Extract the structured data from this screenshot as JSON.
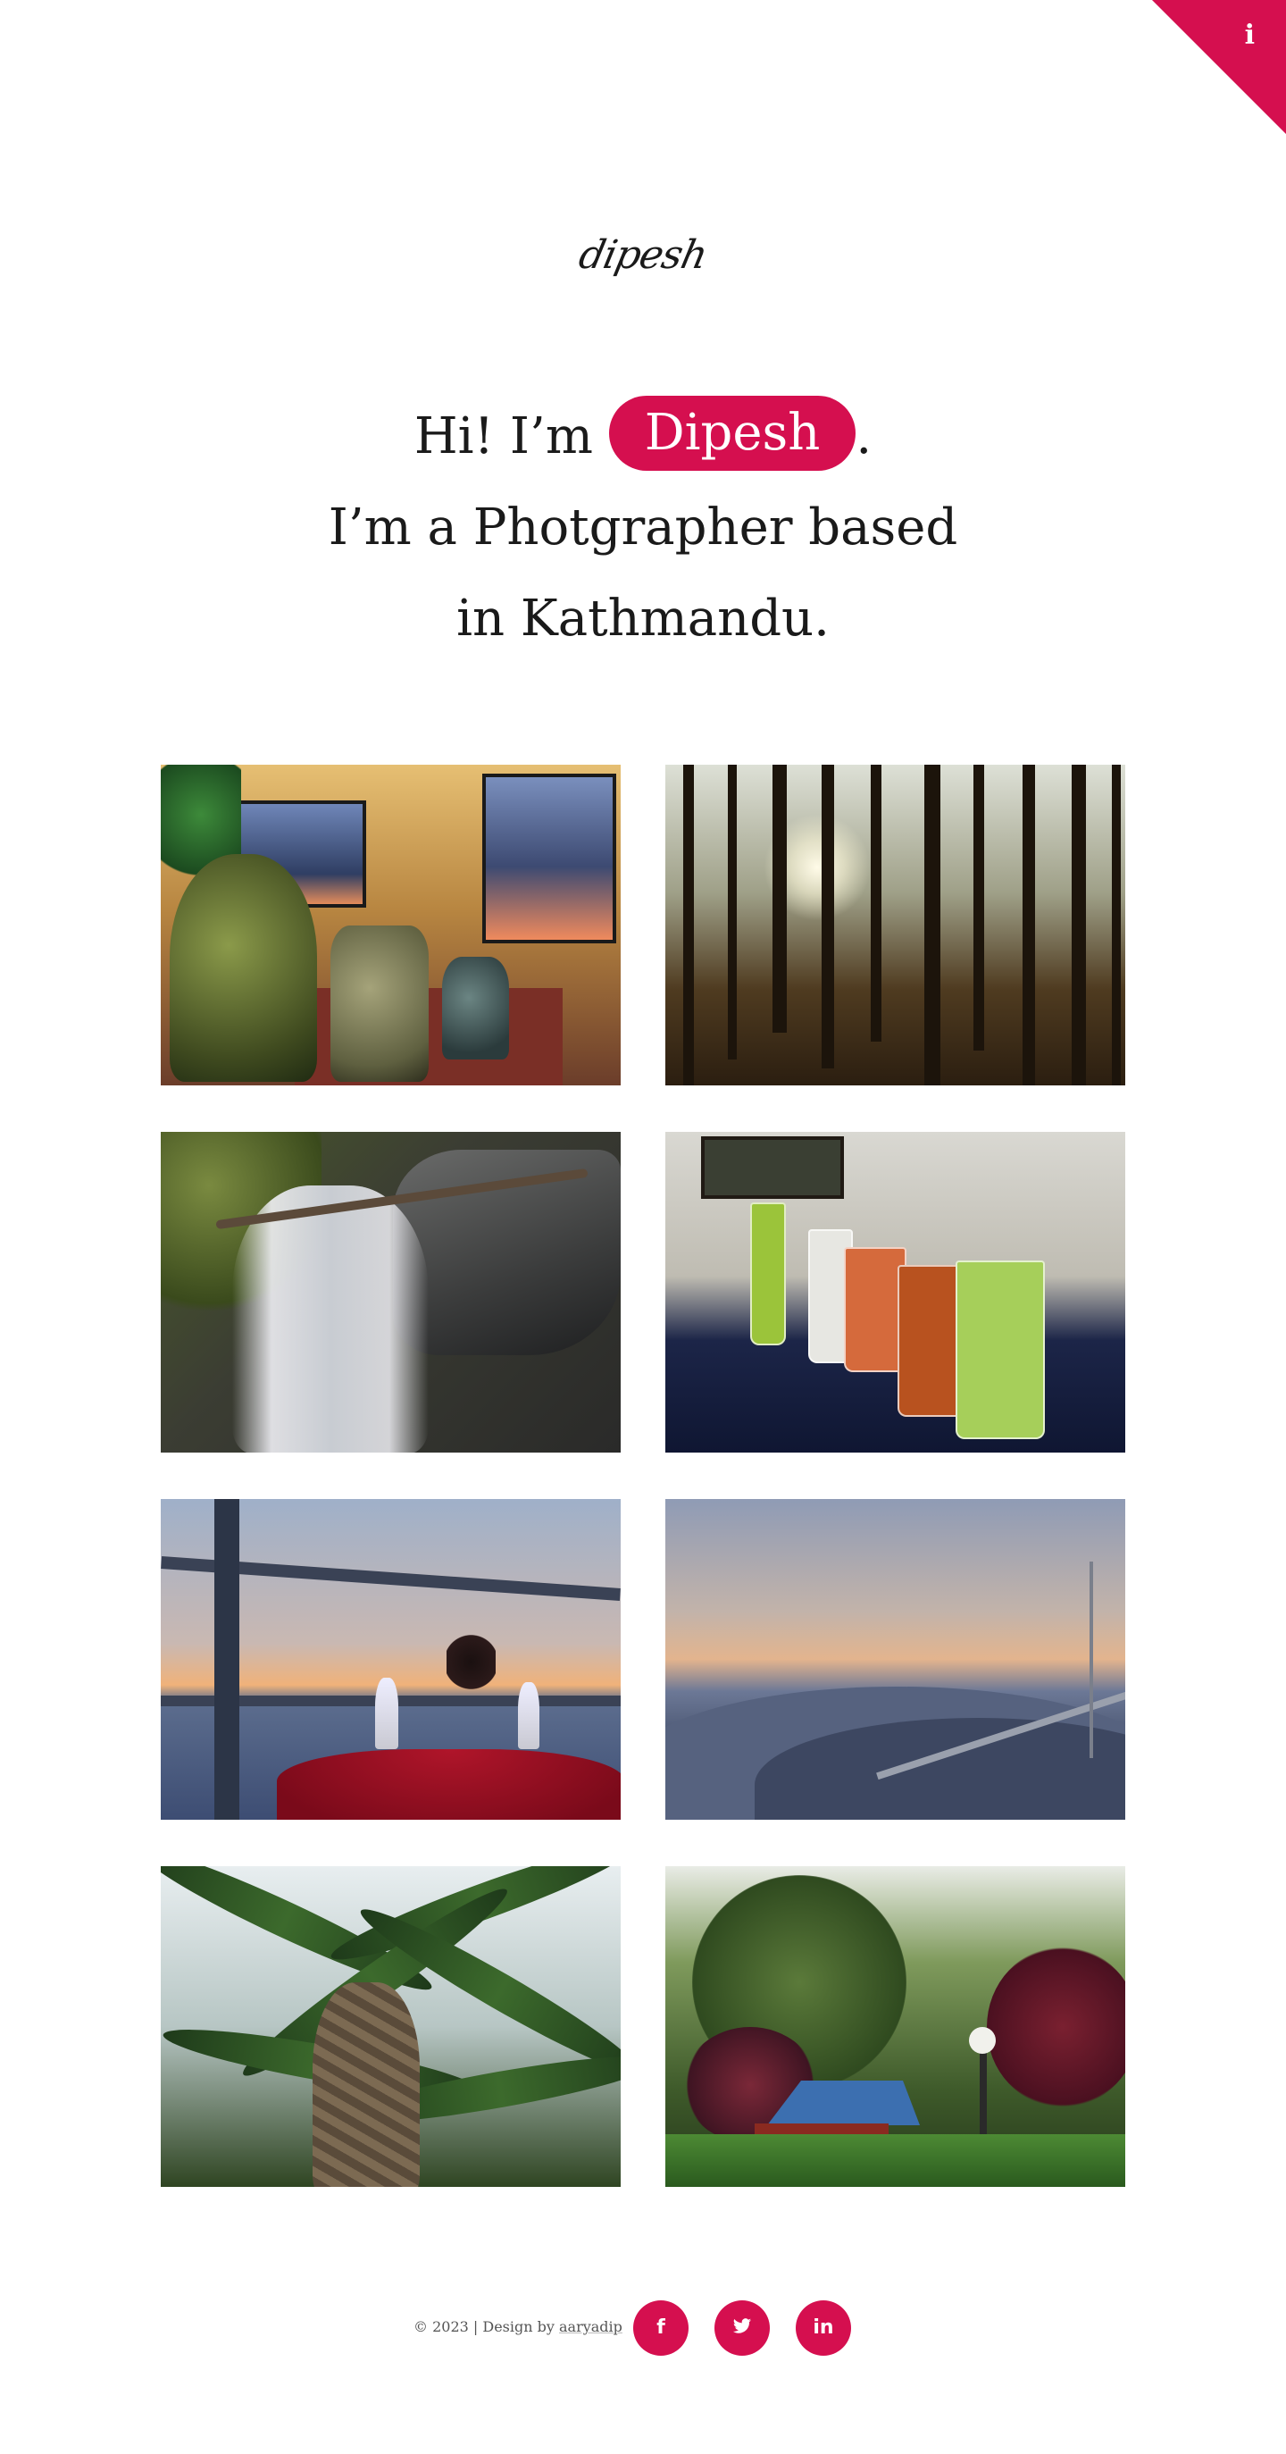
{
  "corner": {
    "glyph": "i",
    "icon": "info-icon",
    "color": "#d50f4f"
  },
  "logo": {
    "text": "dipesh"
  },
  "intro": {
    "greeting": "Hi! I’m",
    "name": "Dipesh",
    "period": ".",
    "line2": "I’m a Photgrapher based",
    "line3": "in Kathmandu."
  },
  "gallery": [
    {
      "subject": "cafe-with-brass-pots"
    },
    {
      "subject": "pine-forest-sunlight"
    },
    {
      "subject": "forest-waterfall"
    },
    {
      "subject": "cocktail-glasses-bar"
    },
    {
      "subject": "balcony-dinner-sunset"
    },
    {
      "subject": "hillside-dusk-view"
    },
    {
      "subject": "palm-tree-canopy"
    },
    {
      "subject": "garden-cottage"
    }
  ],
  "footer": {
    "credit_prefix": "© 2023 | Design by",
    "credit_link": "aaryadip",
    "social": [
      {
        "icon": "facebook-icon",
        "glyph": "f"
      },
      {
        "icon": "twitter-icon",
        "glyph": ""
      },
      {
        "icon": "linkedin-icon",
        "glyph": "in"
      }
    ]
  },
  "colors": {
    "accent": "#d50f4f",
    "background": "#ffffff",
    "text": "#1a1a1a"
  }
}
